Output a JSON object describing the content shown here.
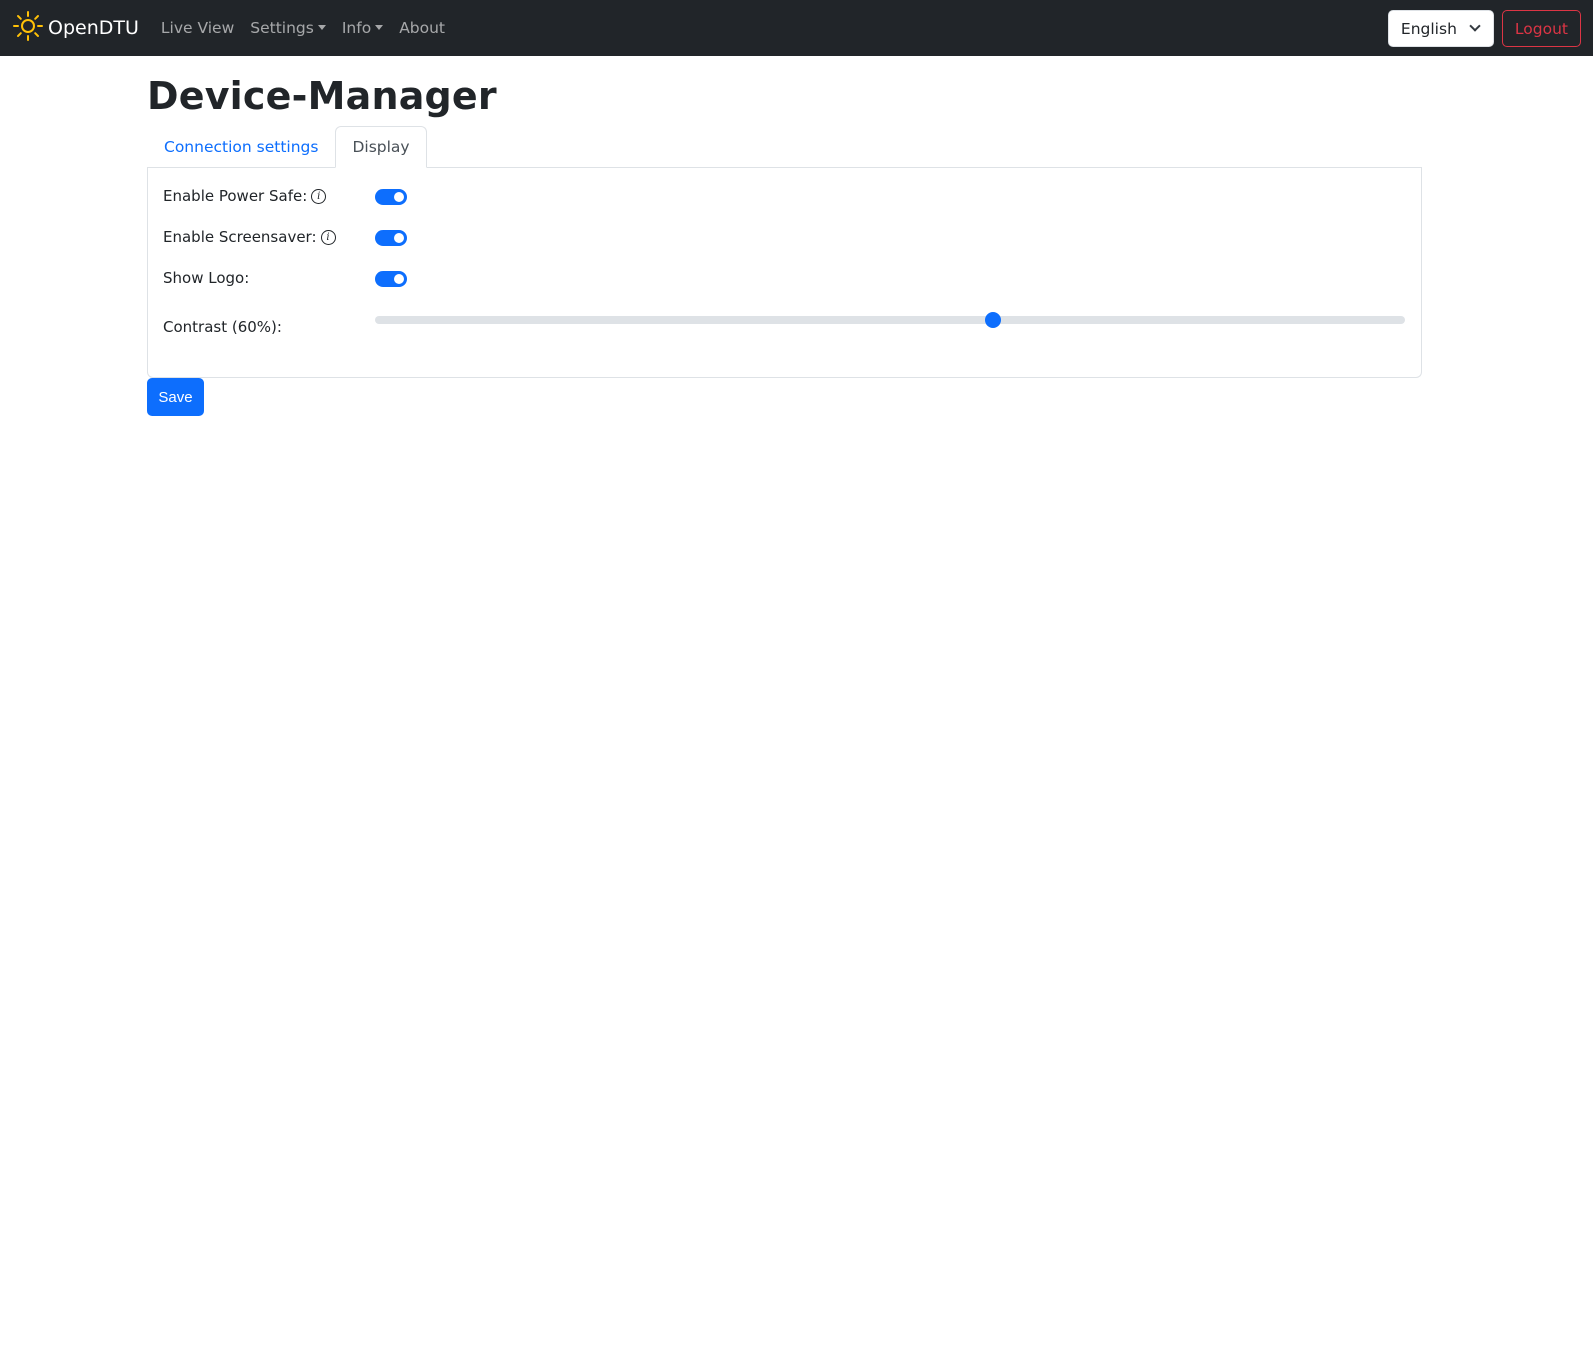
{
  "navbar": {
    "brand": "OpenDTU",
    "brand_icon": "sun-icon",
    "items": [
      {
        "label": "Live View",
        "dropdown": false
      },
      {
        "label": "Settings",
        "dropdown": true
      },
      {
        "label": "Info",
        "dropdown": true
      },
      {
        "label": "About",
        "dropdown": false
      }
    ],
    "language": "English",
    "logout_label": "Logout"
  },
  "page": {
    "title": "Device-Manager",
    "tabs": [
      {
        "label": "Connection settings",
        "active": false
      },
      {
        "label": "Display",
        "active": true
      }
    ]
  },
  "display": {
    "power_safe_label": "Enable Power Safe:",
    "power_safe": true,
    "screensaver_label": "Enable Screensaver:",
    "screensaver": true,
    "show_logo_label": "Show Logo:",
    "show_logo": true,
    "contrast_label": "Contrast (60%):",
    "contrast_percent": 60
  },
  "save_label": "Save",
  "colors": {
    "primary": "#0d6efd",
    "danger": "#dc3545",
    "navbar": "#212529",
    "sun": "#ffc107"
  }
}
